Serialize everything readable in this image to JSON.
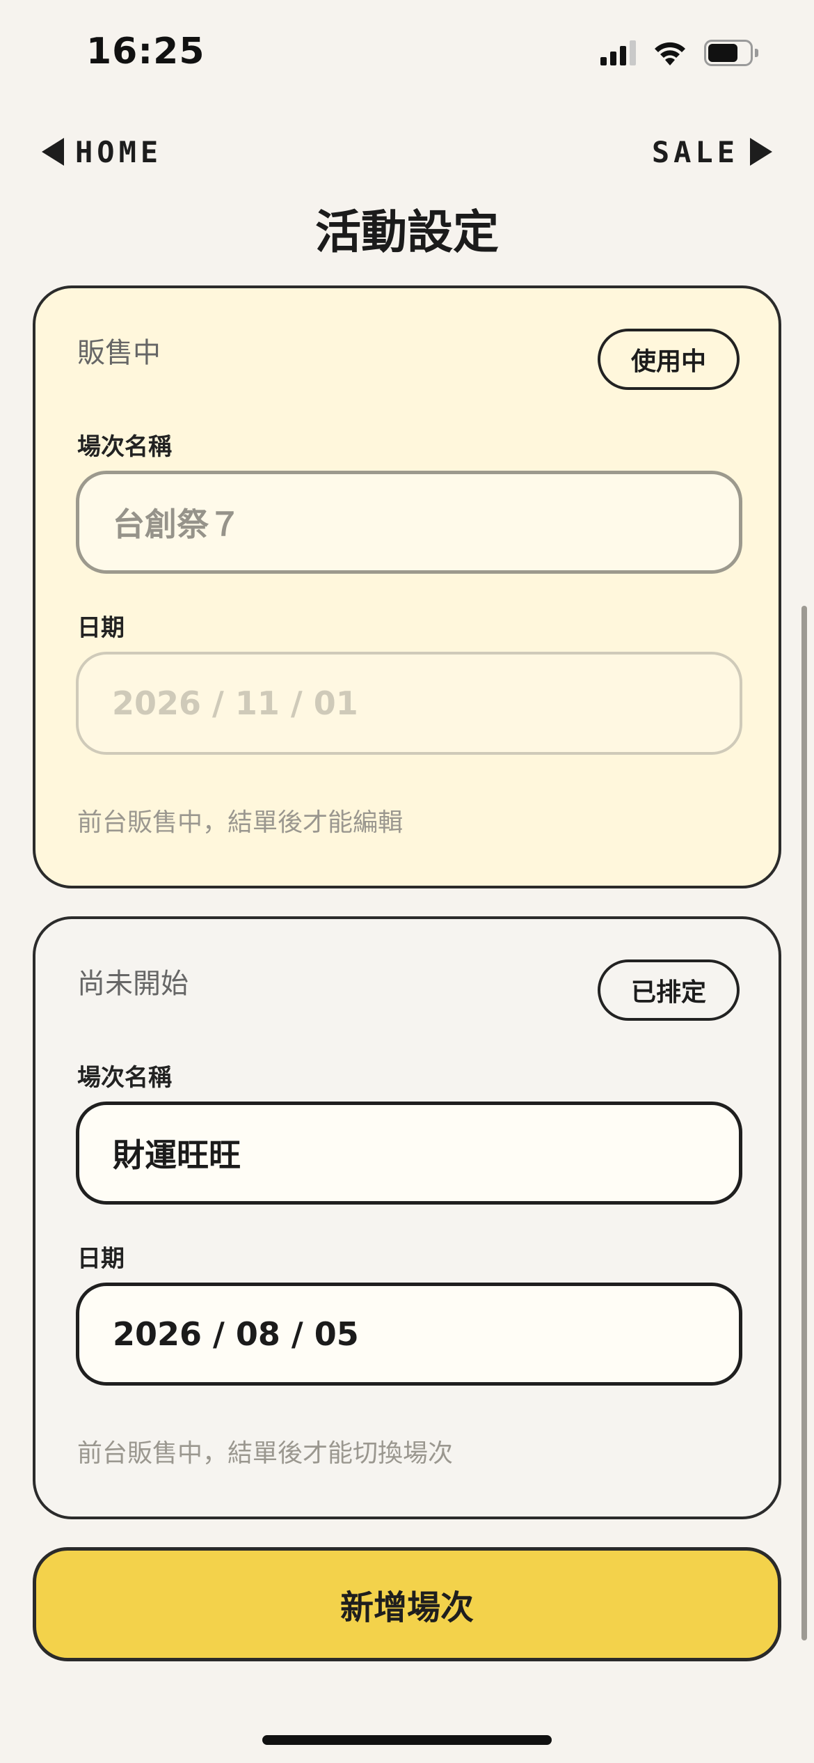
{
  "status_bar": {
    "time": "16:25",
    "icons": [
      "cellular-signal-icon",
      "wifi-icon",
      "battery-icon"
    ]
  },
  "nav": {
    "home_label": "HOME",
    "sale_label": "SALE"
  },
  "page": {
    "title": "活動設定"
  },
  "sessions": [
    {
      "status": "販售中",
      "badge": "使用中",
      "name_label": "場次名稱",
      "name_value": "台創祭７",
      "date_label": "日期",
      "date_value": "2026 / 11 / 01",
      "note": "前台販售中，結單後才能編輯"
    },
    {
      "status": "尚未開始",
      "badge": "已排定",
      "name_label": "場次名稱",
      "name_value": "財運旺旺",
      "date_label": "日期",
      "date_value": "2026 / 08 / 05",
      "note": "前台販售中，結單後才能切換場次"
    }
  ],
  "actions": {
    "add_session_label": "新增場次"
  },
  "colors": {
    "background": "#f6f3ee",
    "active_card": "#fff7dc",
    "upcoming_card": "#f6f4f0",
    "accent_button": "#f3d24b",
    "border": "#2b2b2b"
  }
}
